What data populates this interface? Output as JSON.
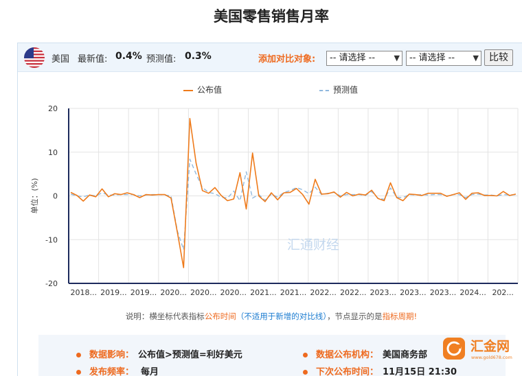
{
  "page": {
    "title": "美国零售销售月率"
  },
  "toolbar": {
    "country": "美国",
    "latest_label": "最新值:",
    "latest_value": "0.4%",
    "forecast_label": "预测值:",
    "forecast_value": "0.3%",
    "compare_label": "添加对比对象:",
    "select1": "-- 请选择 --",
    "select2": "-- 请选择 --",
    "compare_button": "比较"
  },
  "legend": {
    "actual": "公布值",
    "forecast": "预测值"
  },
  "watermark": "汇通财经",
  "note": {
    "p1": "说明：横坐标代表指标",
    "p2": "公布时间",
    "p3": "（不适用于新增的对比线）",
    "p4": "，节点显示的是",
    "p5": "指标周期!"
  },
  "info": {
    "impact_label": "数据影响：",
    "impact_value": "公布值>预测值=利好美元",
    "agency_label": "数据公布机构：",
    "agency_value": "美国商务部",
    "freq_label": "发布频率：",
    "freq_value": "每月",
    "next_label": "下次公布时间：",
    "next_value": "11月15日 21:30"
  },
  "logo": {
    "text": "汇金网",
    "sub": "www.gold678.com"
  },
  "colors": {
    "actual": "#ee7a1a",
    "forecast": "#8fb8de",
    "accent": "#ee6a1f"
  },
  "chart_data": {
    "type": "line",
    "ylabel": "单位：(%)",
    "ylim": [
      -20,
      20
    ],
    "yticks": [
      20,
      10,
      0,
      -10,
      -20
    ],
    "xticks": [
      "2018...",
      "2019...",
      "2019...",
      "2020...",
      "2020...",
      "2020...",
      "2021...",
      "2021...",
      "2022...",
      "2022...",
      "2023...",
      "2023...",
      "2023...",
      "2024...",
      "202..."
    ],
    "series": [
      {
        "name": "公布值",
        "values": [
          0.8,
          0.1,
          -1.2,
          0.2,
          -0.2,
          1.6,
          -0.2,
          0.5,
          0.3,
          0.7,
          0.3,
          -0.4,
          0.3,
          0.2,
          0.3,
          0.3,
          -0.5,
          -8.3,
          -16.4,
          17.7,
          7.5,
          1.2,
          0.6,
          1.9,
          0.1,
          -1.1,
          -0.7,
          5.3,
          -3.0,
          9.8,
          0.0,
          -1.3,
          0.7,
          -0.9,
          0.7,
          0.8,
          1.7,
          0.3,
          -1.9,
          3.8,
          0.4,
          0.5,
          0.9,
          -0.3,
          0.8,
          0.0,
          0.4,
          0.2,
          1.3,
          -0.6,
          -1.1,
          3.0,
          -0.4,
          -1.1,
          0.4,
          0.3,
          0.1,
          0.6,
          0.6,
          0.6,
          -0.1,
          0.3,
          0.7,
          -0.8,
          0.6,
          0.7,
          0.1,
          0.1,
          0.0,
          1.0,
          0.1,
          0.4
        ],
        "color": "#ee7a1a"
      },
      {
        "name": "预测值",
        "values": [
          0.4,
          0.0,
          -0.2,
          0.2,
          0.0,
          0.7,
          0.2,
          0.2,
          0.3,
          0.3,
          0.3,
          0.0,
          0.2,
          0.3,
          0.3,
          0.2,
          0.0,
          -8.0,
          -12.3,
          8.4,
          5.0,
          1.9,
          0.8,
          0.5,
          -0.3,
          -0.5,
          1.1,
          -1.1,
          5.5,
          -0.5,
          0.3,
          -1.0,
          0.4,
          -0.3,
          0.8,
          1.2,
          1.9,
          1.4,
          0.5,
          2.0,
          0.3,
          0.6,
          0.8,
          0.0,
          0.3,
          0.3,
          0.3,
          0.1,
          1.0,
          -0.5,
          -0.8,
          1.8,
          -0.3,
          -0.4,
          0.3,
          0.2,
          0.3,
          0.2,
          0.3,
          0.3,
          0.0,
          0.3,
          0.3,
          -0.4,
          0.3,
          0.4,
          0.2,
          0.2,
          0.0,
          0.3,
          0.2,
          0.3
        ],
        "color": "#8fb8de"
      }
    ]
  }
}
